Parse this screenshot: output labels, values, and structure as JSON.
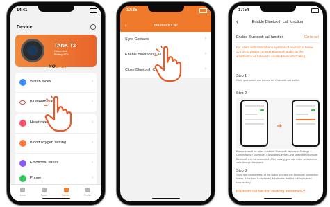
{
  "phone1": {
    "time": "14:41",
    "page_title": "Device",
    "device_name": "TANK T2",
    "device_sub": [
      "Connected",
      "Battery 47%"
    ],
    "brand_prefix": "KO",
    "brand_suffix": "SPET",
    "menu_a": [
      {
        "label": "Watch faces",
        "color": "#3f8cff"
      },
      {
        "label": "Bluetooth Call",
        "color": "#e9453f"
      }
    ],
    "menu_b": [
      {
        "label": "Heart rate",
        "color": "#ff4d6a"
      },
      {
        "label": "Blood oxygen setting",
        "color": "#ff7a3d"
      },
      {
        "label": "Emotional stress",
        "color": "#8a5cf6"
      }
    ],
    "menu_c": [
      {
        "label": "Phone",
        "color": "#35c759"
      }
    ],
    "tabs": [
      "Home",
      "Sport",
      "Device",
      "Profile"
    ],
    "active_tab": "Device"
  },
  "phone2": {
    "time": "17:25",
    "title": "Bluetooth Call",
    "rows": [
      "Sync Contacts",
      "Enable Bluetooth Call",
      "Close Bluetooth Call"
    ]
  },
  "phone3": {
    "time": "17:54",
    "title": "Enable Bluetooth call function",
    "subtitle": "Enable Bluetooth call function",
    "go_to_set": "Go to set",
    "intro": "For users with smartphone systems of Android or below iOS 15.0, please connect Bluetooth audio on the smartwatch as follows to enable Bluetooth Calling.",
    "step1": "Step 1:",
    "step1_text": "Go to your watch and turn on the Bluetooth call switch.",
    "step2": "Step 2:",
    "step2_text": "Please search for other Available Bluetooth devices in Settings > Connections > Bluetooth > Available Devices and select the Bluetooth Bluetooth A to be connected. After pairing, you can make and receive calls through the watch.",
    "step3": "Step 3:",
    "step3_text": "Go to the control menu of the watch to check the Bluetooth connection status. If the icon is displayed, it indicates that the call is enabled successfully.",
    "abnormal_link": "Bluetooth call function enabling abnormality?"
  },
  "colors": {
    "accent": "#f07a2c"
  }
}
